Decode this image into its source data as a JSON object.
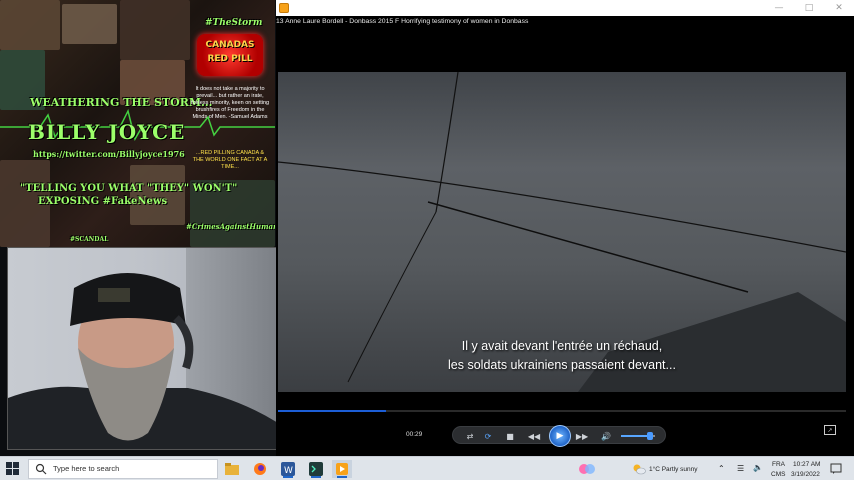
{
  "banner": {
    "weathering": "WEATHERING THE STORM...",
    "name": "BILLY JOYCE",
    "url": "https://twitter.com/Billyjoyce1976",
    "telling": "\"TELLING YOU WHAT \"THEY\" WON'T\"",
    "exposing": "EXPOSING #FakeNews",
    "tag_storm": "#TheStorm",
    "tag_crimes": "#CrimesAgainstHumanity",
    "tag_scandal": "#SCANDAL",
    "canada_l1": "CANADAS",
    "canada_l2": "RED PILL",
    "quote": "It does not take a majority to prevail... but rather an irate, tireless minority, keen on setting brushfires of Freedom in the Minds of Men. -Samuel Adams",
    "quote2": "...RED PILLING CANADA & THE WORLD ONE FACT AT A TIME..."
  },
  "player": {
    "title": "13 Anne Laure Bordell - Donbass 2015 F  Horrifying testimony of women in Donbass",
    "subtitle_line1": "Il y avait devant l'entrée un réchaud,",
    "subtitle_line2": "les soldats ukrainiens passaient devant...",
    "time": "00:29",
    "progress": 0.19,
    "volume": 0.85,
    "colors": {
      "accent": "#1c5ed6",
      "play": "#1f63c7"
    }
  },
  "controls": {
    "shuffle": "shuffle-icon",
    "repeat": "repeat-icon",
    "stop": "stop-icon",
    "previous": "previous-icon",
    "play": "play-icon",
    "next": "next-icon",
    "mute": "volume-icon"
  },
  "taskbar": {
    "search_placeholder": "Type here to search",
    "weather": "1°C  Partly sunny",
    "lang1": "FRA",
    "lang2": "CMS",
    "time": "10:27 AM",
    "date": "3/19/2022"
  }
}
